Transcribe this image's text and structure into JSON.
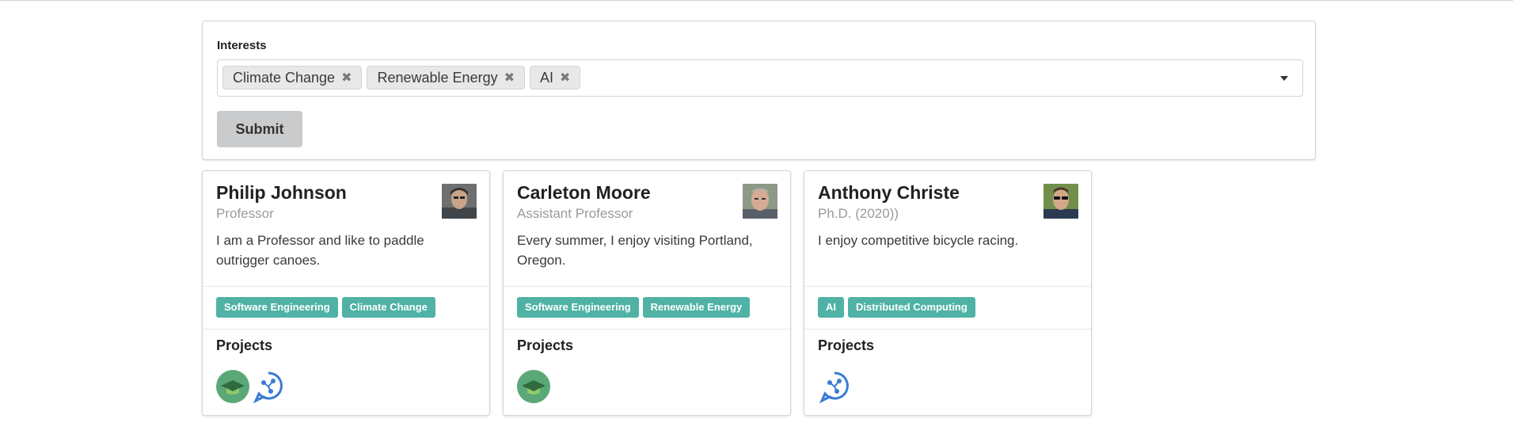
{
  "form": {
    "interests_label": "Interests",
    "selected_interests": [
      "Climate Change",
      "Renewable Energy",
      "AI"
    ],
    "remove_glyph": "✖",
    "submit_label": "Submit"
  },
  "profiles": [
    {
      "name": "Philip Johnson",
      "title": "Professor",
      "bio": "I am a Professor and like to paddle outrigger canoes.",
      "tags": [
        "Software Engineering",
        "Climate Change"
      ],
      "projects_label": "Projects",
      "project_icons": [
        "graduation-cap-icon",
        "chat-circuit-icon"
      ]
    },
    {
      "name": "Carleton Moore",
      "title": "Assistant Professor",
      "bio": "Every summer, I enjoy visiting Portland, Oregon.",
      "tags": [
        "Software Engineering",
        "Renewable Energy"
      ],
      "projects_label": "Projects",
      "project_icons": [
        "graduation-cap-icon"
      ]
    },
    {
      "name": "Anthony Christe",
      "title": "Ph.D. (2020))",
      "bio": "I enjoy competitive bicycle racing.",
      "tags": [
        "AI",
        "Distributed Computing"
      ],
      "projects_label": "Projects",
      "project_icons": [
        "chat-circuit-icon"
      ]
    }
  ],
  "colors": {
    "tag": "#4fb2a5",
    "submit": "#cacbcd",
    "project_blue": "#3a7bd5",
    "project_green": "#5aa877"
  }
}
